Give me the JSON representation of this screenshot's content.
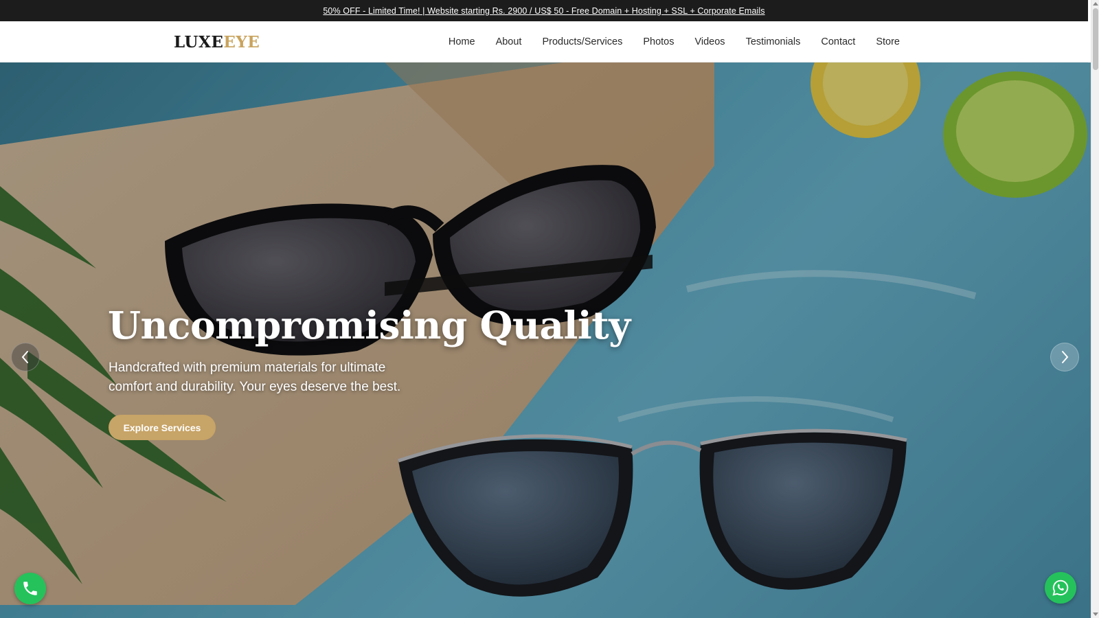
{
  "promo": {
    "text": "50% OFF - Limited Time! | Website starting Rs. 2900 / US$ 50 - Free Domain + Hosting + SSL + Corporate Emails"
  },
  "brand": {
    "logo_part1": "LUXE",
    "logo_part2": "EYE",
    "accent_color": "#c9a45e"
  },
  "nav": {
    "items": [
      {
        "label": "Home"
      },
      {
        "label": "About"
      },
      {
        "label": "Products/Services"
      },
      {
        "label": "Photos"
      },
      {
        "label": "Videos"
      },
      {
        "label": "Testimonials"
      },
      {
        "label": "Contact"
      },
      {
        "label": "Store"
      }
    ]
  },
  "hero": {
    "title": "Uncompromising Quality",
    "subtitle": "Handcrafted with premium materials for ultimate comfort and durability. Your eyes deserve the best.",
    "cta_label": "Explore Services",
    "cta_color": "#c7a467"
  },
  "icons": {
    "prev": "chevron-left-icon",
    "next": "chevron-right-icon",
    "phone": "phone-icon",
    "whatsapp": "whatsapp-icon",
    "fab_color": "#25c25c"
  }
}
